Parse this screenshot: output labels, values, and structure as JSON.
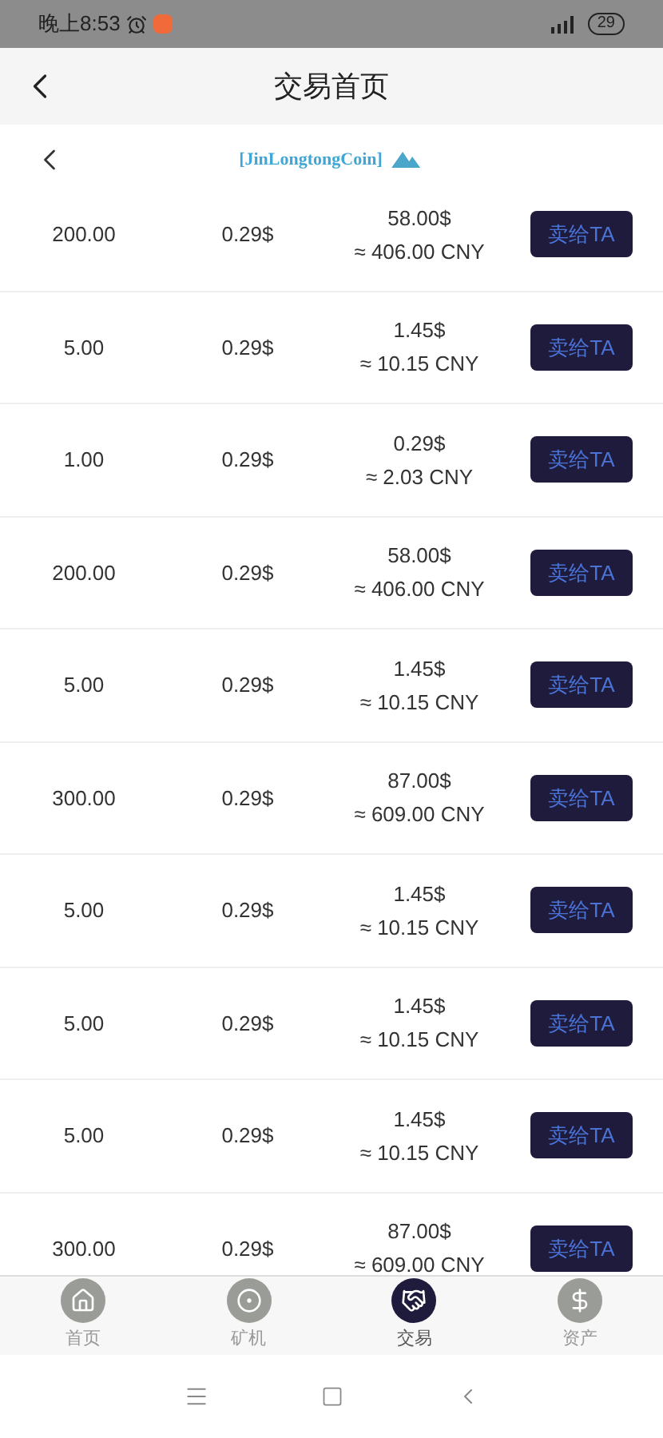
{
  "status_bar": {
    "time": "晚上8:53",
    "battery": "29"
  },
  "header": {
    "title": "交易首页"
  },
  "brand": {
    "name": "[JinLongtongCoin]"
  },
  "orders": [
    {
      "amount": "200.00",
      "price": "0.29$",
      "total": "58.00$",
      "cny": "≈ 406.00 CNY",
      "action": "卖给TA"
    },
    {
      "amount": "5.00",
      "price": "0.29$",
      "total": "1.45$",
      "cny": "≈ 10.15 CNY",
      "action": "卖给TA"
    },
    {
      "amount": "1.00",
      "price": "0.29$",
      "total": "0.29$",
      "cny": "≈ 2.03 CNY",
      "action": "卖给TA"
    },
    {
      "amount": "200.00",
      "price": "0.29$",
      "total": "58.00$",
      "cny": "≈ 406.00 CNY",
      "action": "卖给TA"
    },
    {
      "amount": "5.00",
      "price": "0.29$",
      "total": "1.45$",
      "cny": "≈ 10.15 CNY",
      "action": "卖给TA"
    },
    {
      "amount": "300.00",
      "price": "0.29$",
      "total": "87.00$",
      "cny": "≈ 609.00 CNY",
      "action": "卖给TA"
    },
    {
      "amount": "5.00",
      "price": "0.29$",
      "total": "1.45$",
      "cny": "≈ 10.15 CNY",
      "action": "卖给TA"
    },
    {
      "amount": "5.00",
      "price": "0.29$",
      "total": "1.45$",
      "cny": "≈ 10.15 CNY",
      "action": "卖给TA"
    },
    {
      "amount": "5.00",
      "price": "0.29$",
      "total": "1.45$",
      "cny": "≈ 10.15 CNY",
      "action": "卖给TA"
    },
    {
      "amount": "300.00",
      "price": "0.29$",
      "total": "87.00$",
      "cny": "≈ 609.00 CNY",
      "action": "卖给TA"
    }
  ],
  "tabs": [
    {
      "kind": "home",
      "label": "首页",
      "selected": false
    },
    {
      "kind": "miner",
      "label": "矿机",
      "selected": false
    },
    {
      "kind": "trade",
      "label": "交易",
      "selected": true
    },
    {
      "kind": "assets",
      "label": "资产",
      "selected": false
    }
  ]
}
